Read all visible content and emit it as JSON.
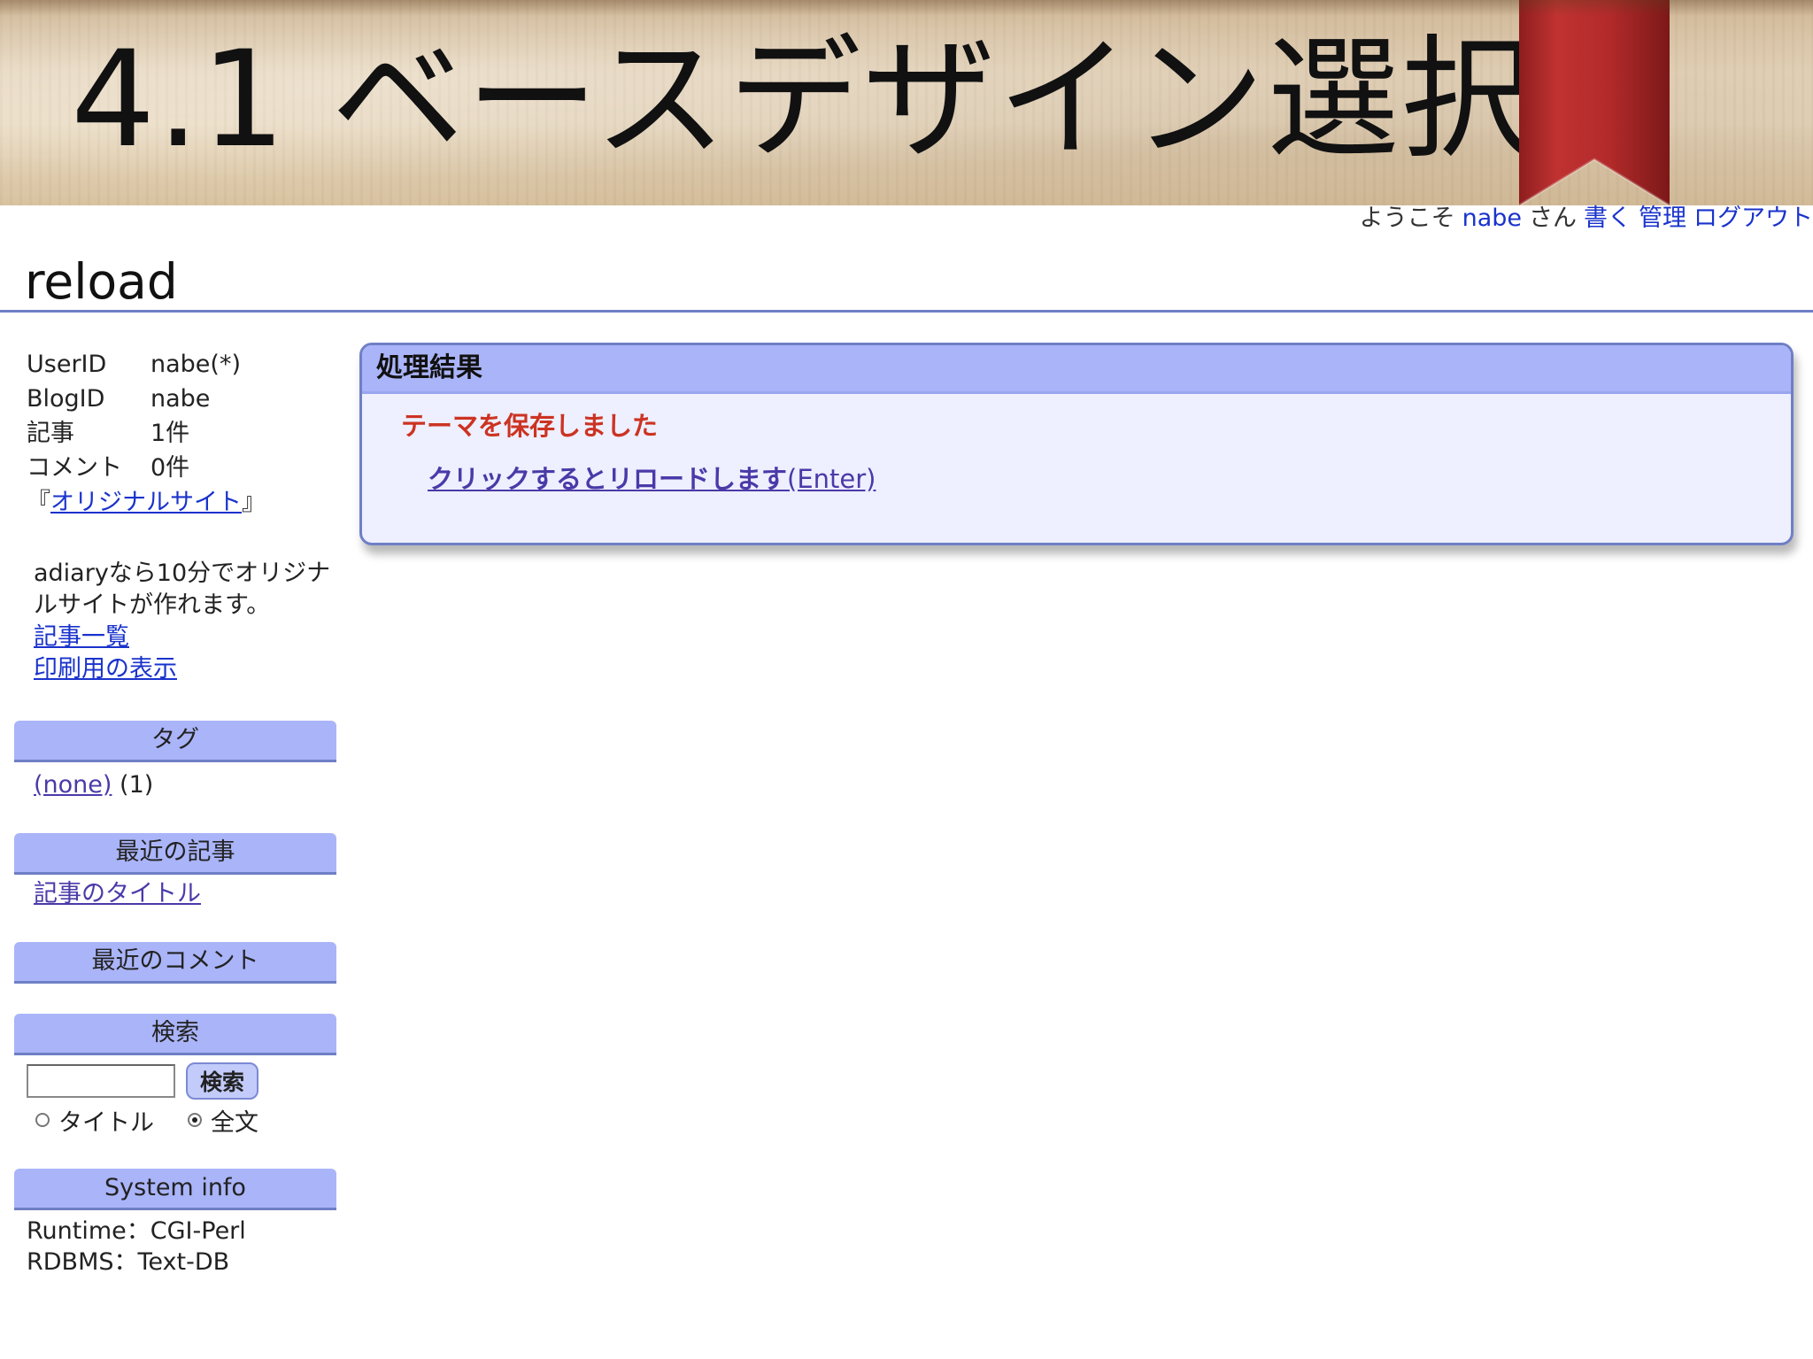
{
  "slide": {
    "title": "4.1 ベースデザイン選択"
  },
  "header": {
    "welcome_prefix": "ようこそ",
    "user": "nabe",
    "welcome_suffix": "さん",
    "write": "書く",
    "manage": "管理",
    "logout": "ログアウト",
    "blog_title": "reload"
  },
  "sidebar": {
    "info": [
      {
        "key": "UserID",
        "value": "nabe(*)"
      },
      {
        "key": "BlogID",
        "value": "nabe"
      },
      {
        "key": "記事",
        "value": "1件"
      },
      {
        "key": "コメント",
        "value": "0件"
      }
    ],
    "orig_open": "『",
    "orig_link": "オリジナルサイト",
    "orig_close": "』",
    "description": "adiaryなら10分でオリジナルサイトが作れます。",
    "link_articles": "記事一覧",
    "link_print": "印刷用の表示",
    "tags_heading": "タグ",
    "tag_name": "(none)",
    "tag_count": "(1)",
    "recent_heading": "最近の記事",
    "recent_item": "記事のタイトル",
    "comments_heading": "最近のコメント",
    "search_heading": "検索",
    "search_value": "",
    "search_button": "検索",
    "radio_title": "タイトル",
    "radio_fulltext": "全文",
    "radio_selected": "全文",
    "sysinfo_heading": "System info",
    "runtime": "Runtime：CGI-Perl",
    "rdbms": "RDBMS：Text-DB"
  },
  "result": {
    "heading": "処理結果",
    "message": "テーマを保存しました",
    "link_text": "クリックするとリロードします",
    "link_key": "(Enter)"
  },
  "colors": {
    "accent": "#aab4f8",
    "border": "#6f7fc6",
    "link": "#1a33cc",
    "visited_link": "#4a3aa8",
    "message": "#cc3322",
    "panel_bg": "#eeefff",
    "ribbon": "#b02a2a"
  }
}
